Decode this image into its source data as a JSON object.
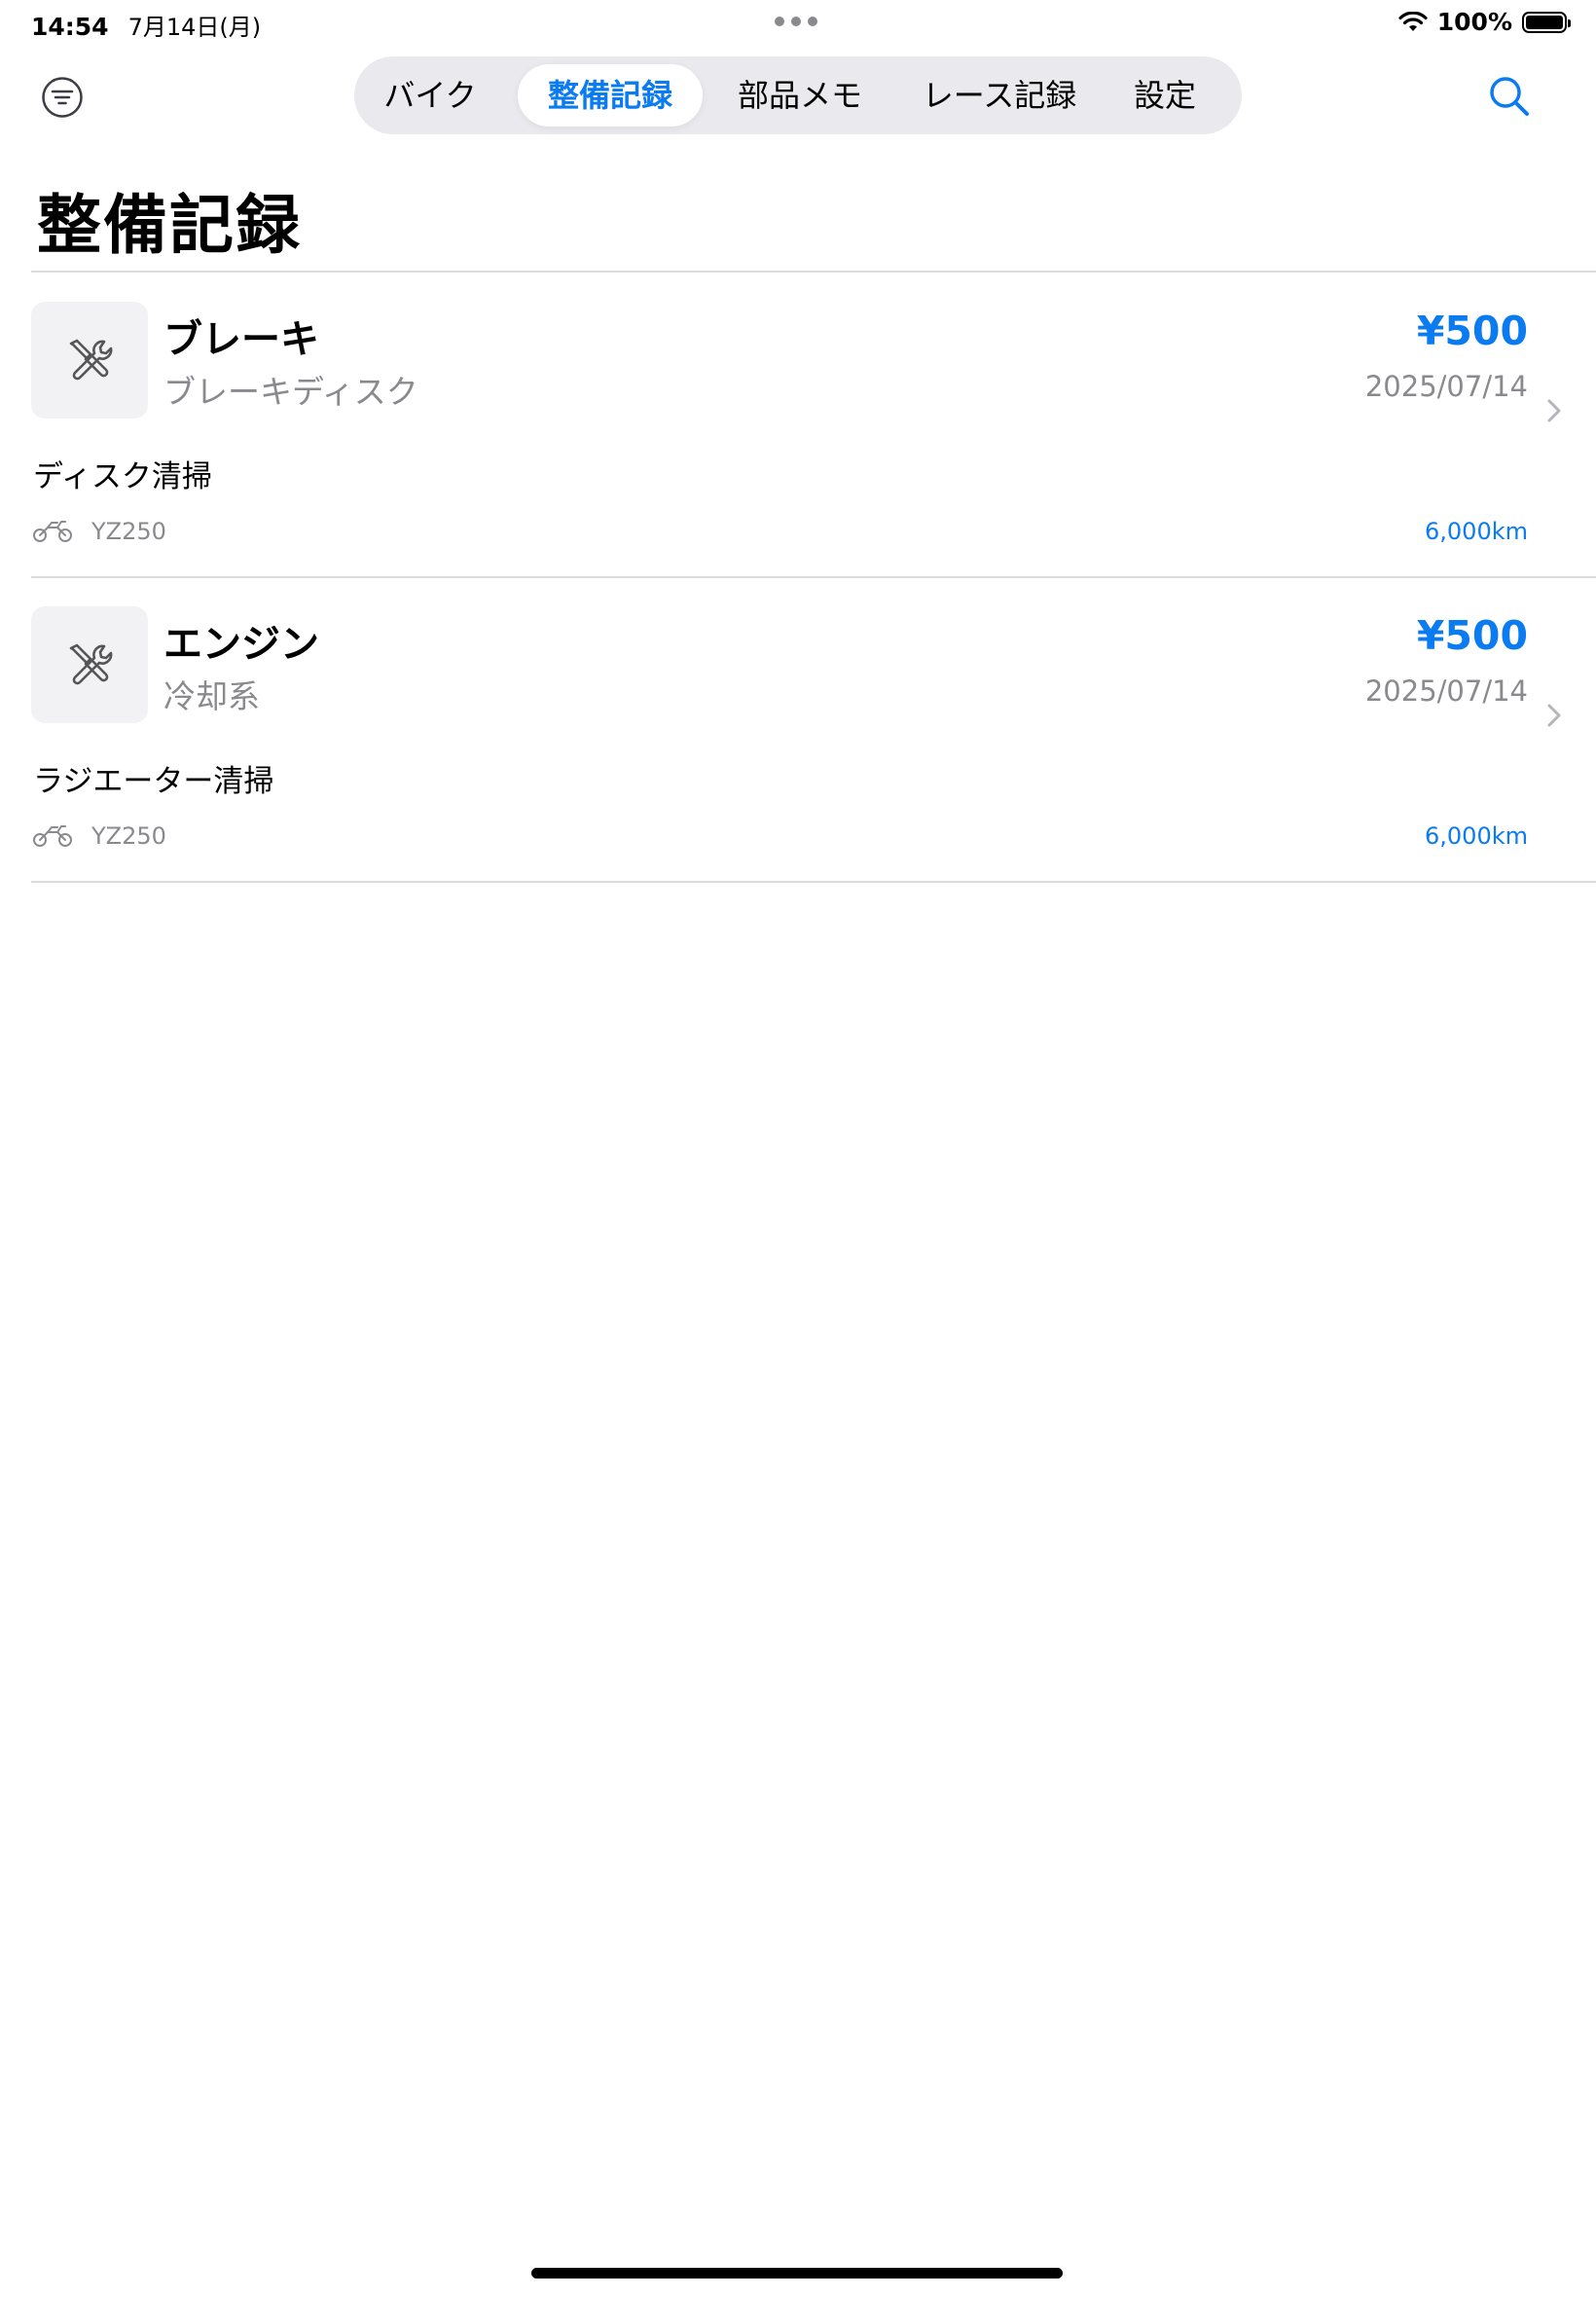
{
  "status_bar": {
    "time": "14:54",
    "date": "7月14日(月)",
    "battery": "100%"
  },
  "nav": {
    "tabs": [
      {
        "label": "バイク"
      },
      {
        "label": "整備記録",
        "active": true
      },
      {
        "label": "部品メモ"
      },
      {
        "label": "レース記録"
      },
      {
        "label": "設定"
      }
    ]
  },
  "page": {
    "title": "整備記録"
  },
  "records": [
    {
      "category": "ブレーキ",
      "part": "ブレーキディスク",
      "price": "¥500",
      "date": "2025/07/14",
      "note": "ディスク清掃",
      "bike": "YZ250",
      "mileage": "6,000km",
      "icon": "wrench-screwdriver-icon"
    },
    {
      "category": "エンジン",
      "part": "冷却系",
      "price": "¥500",
      "date": "2025/07/14",
      "note": "ラジエーター清掃",
      "bike": "YZ250",
      "mileage": "6,000km",
      "icon": "wrench-screwdriver-icon"
    }
  ],
  "colors": {
    "accent": "#0a7bf0",
    "secondary_text": "#8a8a8e",
    "thumb_bg": "#f2f2f5",
    "segment_bg": "#e9e9ee"
  }
}
